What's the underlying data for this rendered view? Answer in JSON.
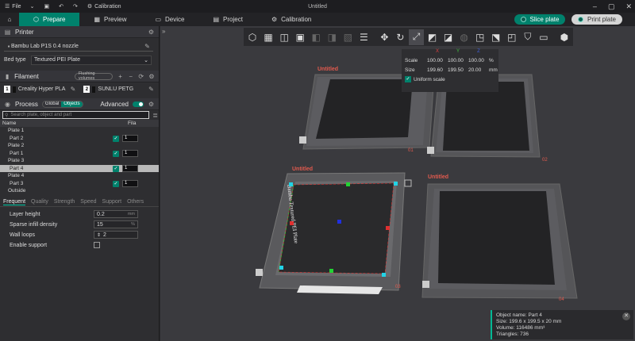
{
  "titlebar": {
    "file_label": "File",
    "calibration_label": "Calibration",
    "app_title": "Untitled"
  },
  "tabs": [
    {
      "label": "Prepare",
      "icon": "cube-icon"
    },
    {
      "label": "Preview",
      "icon": "preview-icon"
    },
    {
      "label": "Device",
      "icon": "device-icon"
    },
    {
      "label": "Project",
      "icon": "project-icon"
    },
    {
      "label": "Calibration",
      "icon": "calibration-icon"
    }
  ],
  "actions": {
    "slice_label": "Slice plate",
    "print_label": "Print plate"
  },
  "printer": {
    "header": "Printer",
    "name": "Bambu Lab P1S 0.4 nozzle",
    "bed_type_label": "Bed type",
    "bed_type_value": "Textured PEI Plate"
  },
  "filament": {
    "header": "Filament",
    "chip": "Flushing volumes",
    "items": [
      {
        "num": "1",
        "name": "Creality Hyper PLA",
        "color": "#111111"
      },
      {
        "num": "2",
        "name": "SUNLU PETG",
        "color": "#111111"
      }
    ]
  },
  "process": {
    "header": "Process",
    "global_label": "Global",
    "objects_label": "Objects",
    "advanced_label": "Advanced",
    "search_placeholder": "Search plate, object and part"
  },
  "object_list": {
    "col_name": "Name",
    "col_fila": "Fila",
    "rows": [
      {
        "label": "Plate 1",
        "indent": 0
      },
      {
        "label": "Part 2",
        "indent": 1,
        "fila": "1",
        "checked": true
      },
      {
        "label": "Plate 2",
        "indent": 0
      },
      {
        "label": "Part 1",
        "indent": 1,
        "fila": "1",
        "checked": true
      },
      {
        "label": "Plate 3",
        "indent": 0
      },
      {
        "label": "Part 4",
        "indent": 1,
        "fila": "1",
        "checked": true,
        "selected": true
      },
      {
        "label": "Plate 4",
        "indent": 0
      },
      {
        "label": "Part 3",
        "indent": 1,
        "fila": "1",
        "checked": true
      },
      {
        "label": "Outside",
        "indent": 0
      }
    ]
  },
  "param_tabs": [
    "Frequent",
    "Quality",
    "Strength",
    "Speed",
    "Support",
    "Others"
  ],
  "params": {
    "layer_height_label": "Layer height",
    "layer_height_value": "0.2",
    "layer_height_unit": "mm",
    "infill_label": "Sparse infill density",
    "infill_value": "15",
    "infill_unit": "%",
    "walls_label": "Wall loops",
    "walls_value": "2",
    "support_label": "Enable support"
  },
  "scale_panel": {
    "axes": [
      "X",
      "Y",
      "Z"
    ],
    "axis_colors": [
      "#e04040",
      "#40c040",
      "#4060e0"
    ],
    "scale_label": "Scale",
    "scale_values": [
      "100.00",
      "100.00",
      "100.00"
    ],
    "scale_unit": "%",
    "size_label": "Size",
    "size_values": [
      "199.60",
      "199.50",
      "20.00"
    ],
    "size_unit": "mm",
    "uniform_label": "Uniform scale"
  },
  "plates": [
    {
      "title": "Untitled",
      "number": "01"
    },
    {
      "title": "",
      "number": "02"
    },
    {
      "title": "Untitled",
      "number": "03",
      "bed_text": "Bambu Textured PEI Plate"
    },
    {
      "title": "Untitled",
      "number": "04"
    }
  ],
  "object_info": {
    "name": "Object name: Part 4",
    "size": "Size: 199.6 x 199.5 x 20 mm",
    "volume": "Volume: 116486 mm³",
    "triangles": "Triangles: 736"
  }
}
